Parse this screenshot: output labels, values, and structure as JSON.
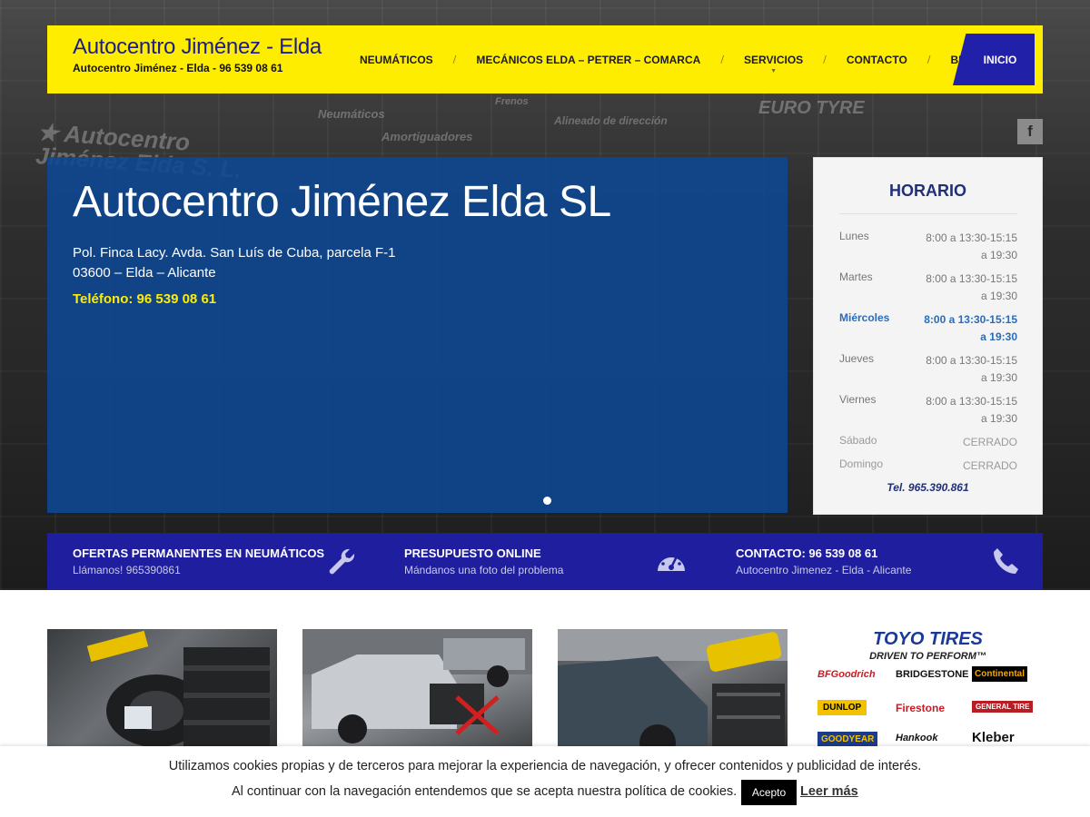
{
  "header": {
    "title": "Autocentro Jiménez - Elda",
    "subtitle": "Autocentro Jiménez - Elda - 96 539 08 61",
    "nav": [
      {
        "label": "NEUMÁTICOS",
        "dropdown": false
      },
      {
        "label": "MECÁNICOS ELDA – PETRER – COMARCA",
        "dropdown": false
      },
      {
        "label": "SERVICIOS",
        "dropdown": true
      },
      {
        "label": "CONTACTO",
        "dropdown": false
      },
      {
        "label": "BLOG",
        "dropdown": true
      }
    ],
    "home_label": "INICIO",
    "facebook_label": "f"
  },
  "hero_signs": {
    "big": "★ Autocentro\nJiménez Elda S. L.",
    "neumaticos": "Neumáticos",
    "amortiguadores": "Amortiguadores",
    "frenos": "Frenos",
    "alineado": "Alineado de dirección",
    "tyre": "EURO TYRE"
  },
  "slider": {
    "title": "Autocentro Jiménez Elda SL",
    "address_line1": "Pol. Finca Lacy. Avda. San Luís de Cuba, parcela F-1",
    "address_line2": "03600 – Elda – Alicante",
    "phone": "Teléfono: 96 539 08 61"
  },
  "horario": {
    "title": "HORARIO",
    "rows": [
      {
        "day": "Lunes",
        "time": "8:00 a 13:30-15:15 a 19:30"
      },
      {
        "day": "Martes",
        "time": "8:00 a 13:30-15:15 a 19:30"
      },
      {
        "day": "Miércoles",
        "time": "8:00 a 13:30-15:15 a 19:30"
      },
      {
        "day": "Jueves",
        "time": "8:00 a 13:30-15:15 a 19:30"
      },
      {
        "day": "Viernes",
        "time": "8:00 a 13:30-15:15 a 19:30"
      },
      {
        "day": "Sábado",
        "time": "CERRADO"
      },
      {
        "day": "Domingo",
        "time": "CERRADO"
      }
    ],
    "tel": "Tel. 965.390.861"
  },
  "features": [
    {
      "title": "OFERTAS PERMANENTES EN NEUMÁTICOS",
      "subtitle": "Llámanos! 965390861",
      "icon": "wrench-icon"
    },
    {
      "title": "PRESUPUESTO ONLINE",
      "subtitle": "Mándanos una foto del problema",
      "icon": "speedometer-icon"
    },
    {
      "title": "CONTACTO: 96 539 08 61",
      "subtitle": "Autocentro Jimenez - Elda - Alicante",
      "icon": "phone-icon"
    }
  ],
  "brands": {
    "toyo": "TOYO TIRES",
    "toyo_tagline": "DRIVEN TO PERFORM™",
    "logos": [
      "BFGoodrich",
      "BRIDGESTONE",
      "Continental",
      "DUNLOP",
      "Firestone",
      "GENERAL TIRE",
      "GOODYEAR",
      "Hankook",
      "Kleber"
    ]
  },
  "cookie": {
    "line1": "Utilizamos cookies propias y de terceros para mejorar la experiencia de navegación, y ofrecer contenidos y publicidad de interés.",
    "line2": "Al continuar con la navegación entendemos que se acepta nuestra política de cookies.",
    "accept_label": "Acepto",
    "more_label": "Leer más"
  },
  "colors": {
    "header_yellow": "#ffed00",
    "brand_blue": "#1e1e9e",
    "slider_blue": "#0d4894",
    "active_day": "#2b6cb8"
  }
}
